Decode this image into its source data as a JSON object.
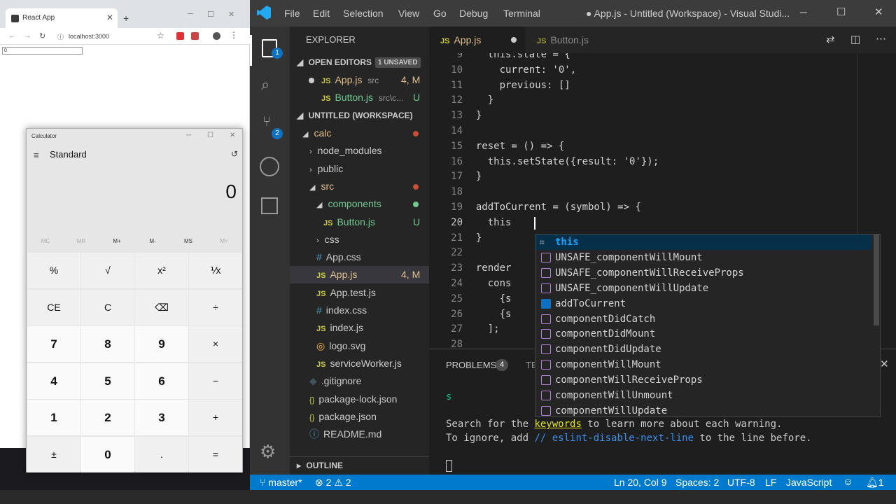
{
  "chrome": {
    "tab_title": "React App",
    "url": "localhost:3000",
    "input_value": "0"
  },
  "calculator": {
    "title": "Calculator",
    "mode": "Standard",
    "display": "0",
    "memory": [
      "MC",
      "MR",
      "M+",
      "M-",
      "MS",
      "M˅"
    ],
    "keys": [
      [
        "%",
        "√",
        "x²",
        "⅟x"
      ],
      [
        "CE",
        "C",
        "⌫",
        "÷"
      ],
      [
        "7",
        "8",
        "9",
        "×"
      ],
      [
        "4",
        "5",
        "6",
        "−"
      ],
      [
        "1",
        "2",
        "3",
        "+"
      ],
      [
        "±",
        "0",
        ".",
        "="
      ]
    ]
  },
  "vscode": {
    "menu": [
      "File",
      "Edit",
      "Selection",
      "View",
      "Go",
      "Debug",
      "Terminal"
    ],
    "window_title": "● App.js - Untitled (Workspace) - Visual Studi...",
    "activity_badges": {
      "explorer": "1",
      "scm": "2"
    },
    "explorer_title": "EXPLORER",
    "open_editors": {
      "label": "OPEN EDITORS",
      "unsaved": "1 UNSAVED",
      "items": [
        {
          "name": "App.js",
          "path": "src",
          "status": "4, M"
        },
        {
          "name": "Button.js",
          "path": "src\\c...",
          "status": "U"
        }
      ]
    },
    "workspace": {
      "label": "UNTITLED (WORKSPACE)",
      "items": [
        "calc",
        "node_modules",
        "public",
        "src",
        "components",
        "Button.js",
        "css",
        "App.css",
        "App.js",
        "App.test.js",
        "index.css",
        "index.js",
        "logo.svg",
        "serviceWorker.js",
        ".gitignore",
        "package-lock.json",
        "package.json",
        "README.md"
      ],
      "button_status": "U",
      "app_status": "4, M"
    },
    "outline_label": "OUTLINE",
    "tabs": [
      {
        "label": "App.js"
      },
      {
        "label": "Button.js"
      }
    ],
    "code_lines": [
      {
        "n": "9",
        "t": "    this.state = {"
      },
      {
        "n": "10",
        "t": "      current: '0',"
      },
      {
        "n": "11",
        "t": "      previous: []"
      },
      {
        "n": "12",
        "t": "    }"
      },
      {
        "n": "13",
        "t": "  }"
      },
      {
        "n": "14",
        "t": ""
      },
      {
        "n": "15",
        "t": "  reset = () => {"
      },
      {
        "n": "16",
        "t": "    this.setState({result: '0'});"
      },
      {
        "n": "17",
        "t": "  }"
      },
      {
        "n": "18",
        "t": ""
      },
      {
        "n": "19",
        "t": "  addToCurrent = (symbol) => {"
      },
      {
        "n": "20",
        "t": "    this"
      },
      {
        "n": "21",
        "t": "  }"
      },
      {
        "n": "22",
        "t": ""
      },
      {
        "n": "23",
        "t": "  render"
      },
      {
        "n": "24",
        "t": "    cons"
      },
      {
        "n": "25",
        "t": "      {s"
      },
      {
        "n": "26",
        "t": "      {s"
      },
      {
        "n": "27",
        "t": "    ];"
      },
      {
        "n": "28",
        "t": ""
      }
    ],
    "autocomplete": [
      "this",
      "UNSAFE_componentWillMount",
      "UNSAFE_componentWillReceiveProps",
      "UNSAFE_componentWillUpdate",
      "addToCurrent",
      "componentDidCatch",
      "componentDidMount",
      "componentDidUpdate",
      "componentWillMount",
      "componentWillReceiveProps",
      "componentWillUnmount",
      "componentWillUpdate"
    ],
    "panel": {
      "tab_problems": "PROBLEMS",
      "problems_count": "4",
      "tab_terminal": "TE",
      "line1": "s",
      "line2a": "Search for the ",
      "line2b": "keywords",
      "line2c": " to learn more about each warning.",
      "line3a": "To ignore, add ",
      "line3b": "// eslint-disable-next-line",
      "line3c": " to the line before."
    },
    "status": {
      "branch": "master*",
      "errors": "2",
      "warnings": "2",
      "position": "Ln 20, Col 9",
      "spaces": "Spaces: 2",
      "encoding": "UTF-8",
      "eol": "LF",
      "language": "JavaScript",
      "bell_count": "1"
    }
  }
}
